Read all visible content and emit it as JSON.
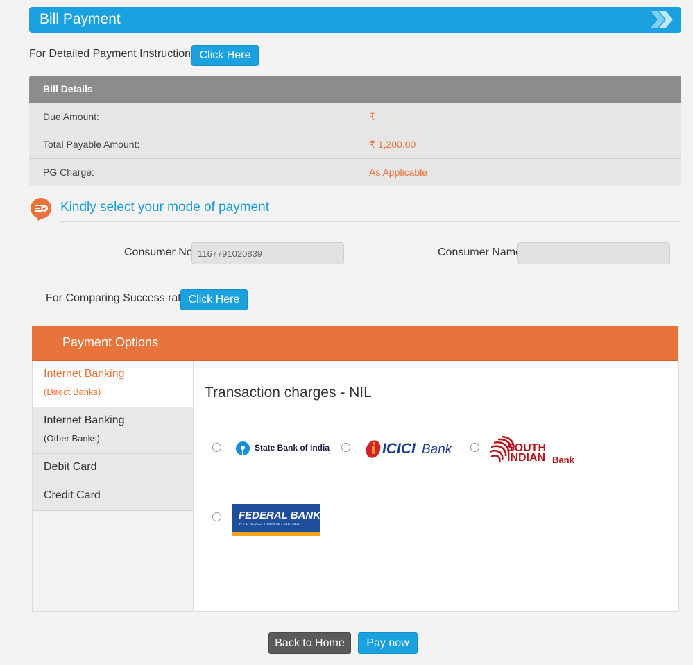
{
  "header": {
    "title": "Bill Payment"
  },
  "instructions": {
    "label": "For Detailed Payment Instructions",
    "button": "Click Here"
  },
  "bill_details": {
    "title": "Bill Details",
    "rows": [
      {
        "label": "Due Amount:",
        "value": "₹"
      },
      {
        "label": "Total Payable Amount:",
        "value": "₹ 1,200.00"
      },
      {
        "label": "PG Charge:",
        "value": "As Applicable"
      }
    ]
  },
  "mode": {
    "title": "Kindly select your mode of payment"
  },
  "consumer": {
    "no_label": "Consumer No:",
    "no_value": "1167791020839",
    "name_label": "Consumer Name:",
    "name_value": ""
  },
  "compare": {
    "label": "For Comparing Success rate",
    "button": "Click Here"
  },
  "payment_options": {
    "title": "Payment Options",
    "tabs": [
      {
        "line1": "Internet Banking",
        "line2": "(Direct Banks)"
      },
      {
        "line1": "Internet Banking",
        "line2": "(Other Banks)"
      },
      {
        "line1": "Debit Card"
      },
      {
        "line1": "Credit Card"
      }
    ],
    "transaction_charges": "Transaction charges - NIL",
    "banks": {
      "sbi": "State Bank of India",
      "icici_1": "ICICI",
      "icici_2": "Bank",
      "south_1": "SOUTH",
      "south_2": "INDIAN",
      "south_3": "Bank",
      "federal_1": "FEDERAL BANK",
      "federal_2": "YOUR PERFECT BANKING PARTNER"
    }
  },
  "footer": {
    "back": "Back to Home",
    "pay": "Pay now"
  },
  "colors": {
    "accent_blue": "#1aa1e0",
    "accent_orange": "#e8743b",
    "header_grey": "#8c8c8c"
  }
}
